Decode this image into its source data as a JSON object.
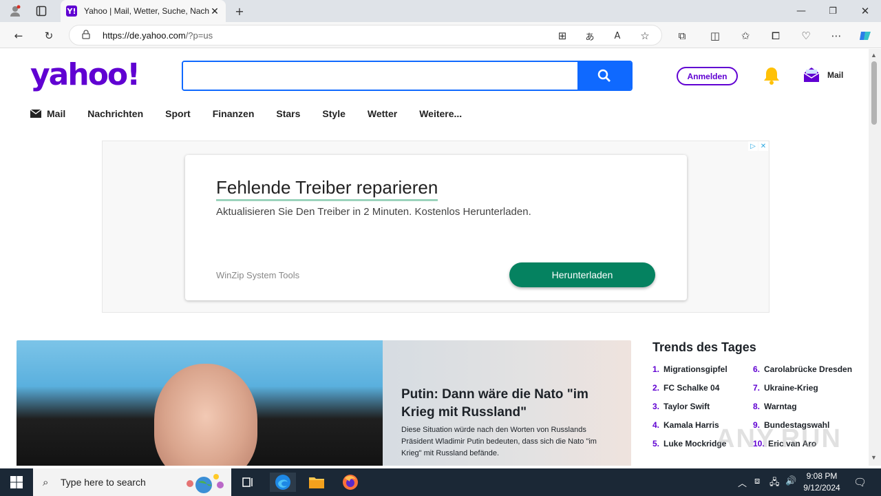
{
  "browser": {
    "tab_title": "Yahoo | Mail, Wetter, Suche, Nachrichten",
    "tab_favicon": "Y!",
    "url_host": "https://de.yahoo.com",
    "url_path": "/?p=us"
  },
  "header": {
    "logo": "yahoo!",
    "search_placeholder": "",
    "signin_label": "Anmelden",
    "mail_label": "Mail"
  },
  "nav": {
    "items": [
      "Mail",
      "Nachrichten",
      "Sport",
      "Finanzen",
      "Stars",
      "Style",
      "Wetter",
      "Weitere..."
    ]
  },
  "ad": {
    "title": "Fehlende Treiber reparieren",
    "text": "Aktualisieren Sie Den Treiber in 2 Minuten. Kostenlos Herunterladen.",
    "sponsor": "WinZip System Tools",
    "button": "Herunterladen"
  },
  "hero": {
    "title": "Putin: Dann wäre die Nato \"im Krieg mit Russland\"",
    "description": "Diese Situation würde nach den Worten von Russlands Präsident Wladimir Putin bedeuten, dass sich die Nato \"im Krieg\" mit Russland befände."
  },
  "trends": {
    "heading": "Trends des Tages",
    "left": [
      {
        "n": "1.",
        "label": "Migrationsgipfel"
      },
      {
        "n": "2.",
        "label": "FC Schalke 04"
      },
      {
        "n": "3.",
        "label": "Taylor Swift"
      },
      {
        "n": "4.",
        "label": "Kamala Harris"
      },
      {
        "n": "5.",
        "label": "Luke Mockridge"
      }
    ],
    "right": [
      {
        "n": "6.",
        "label": "Carolabrücke Dresden"
      },
      {
        "n": "7.",
        "label": "Ukraine-Krieg"
      },
      {
        "n": "8.",
        "label": "Warntag"
      },
      {
        "n": "9.",
        "label": "Bundestagswahl"
      },
      {
        "n": "10.",
        "label": "Eric van Aro"
      }
    ]
  },
  "watermark": "ANY.RUN",
  "taskbar": {
    "search_placeholder": "Type here to search",
    "time": "9:08 PM",
    "date": "9/12/2024"
  },
  "colors": {
    "brand": "#6001d2",
    "search_blue": "#0f69ff",
    "ad_button": "#058260"
  }
}
